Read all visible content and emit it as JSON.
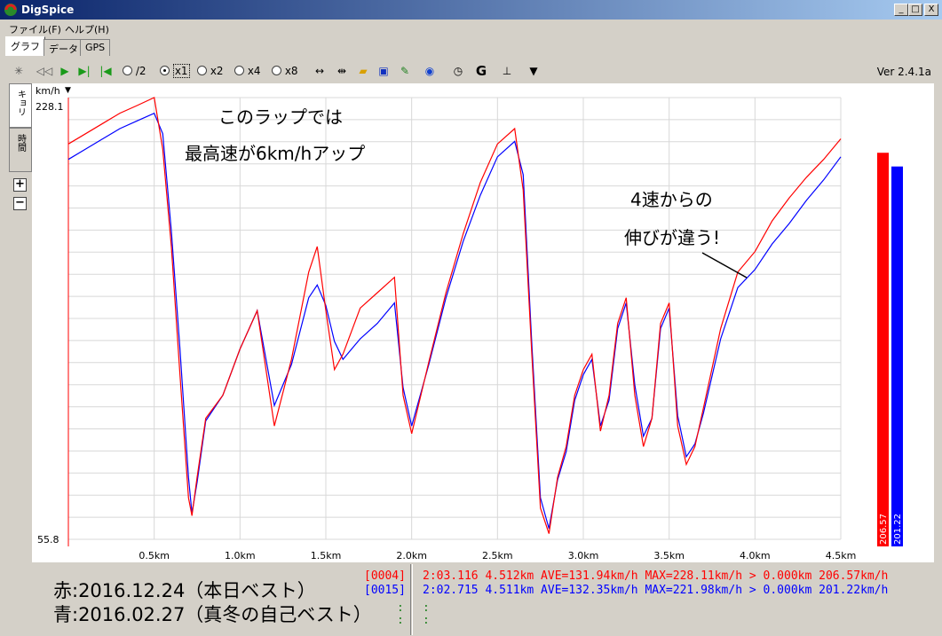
{
  "window": {
    "title": "DigSpice",
    "minimize": "_",
    "maximize": "□",
    "close": "X"
  },
  "menu": {
    "file": "ファイル(F)",
    "help": "ヘルプ(H)"
  },
  "tabs": [
    "グラフ",
    "データ",
    "GPS"
  ],
  "toolbar": {
    "radios": [
      {
        "label": "/2",
        "selected": false
      },
      {
        "label": "x1",
        "selected": true
      },
      {
        "label": "x2",
        "selected": false
      },
      {
        "label": "x4",
        "selected": false
      },
      {
        "label": "x8",
        "selected": false
      }
    ],
    "g_label": "G",
    "version": "Ver 2.4.1a"
  },
  "side": {
    "tab_distance": "キョリ",
    "tab_time": "時間",
    "zoom_in": "+",
    "zoom_out": "−"
  },
  "annotations": {
    "line1": "このラップでは",
    "line2": "最高速が6km/hアップ",
    "line3": "4速からの",
    "line4": "伸びが違う!"
  },
  "colors": {
    "red": "#ff0000",
    "blue": "#0000ff",
    "grid": "#d8d8d8"
  },
  "chart_data": {
    "type": "line",
    "ylabel": "km/h",
    "ylim": [
      55.8,
      228.1
    ],
    "y_tick_labels": [
      "228.1",
      "55.8"
    ],
    "xlim": [
      0,
      4.5
    ],
    "x_tick_labels": [
      "0.5km",
      "1.0km",
      "1.5km",
      "2.0km",
      "2.5km",
      "3.0km",
      "3.5km",
      "4.0km",
      "4.5km"
    ],
    "grid": true,
    "series": [
      {
        "color": "#ff0000",
        "x": [
          0,
          0.1,
          0.2,
          0.3,
          0.4,
          0.5,
          0.55,
          0.6,
          0.65,
          0.7,
          0.72,
          0.75,
          0.8,
          0.9,
          1.0,
          1.1,
          1.2,
          1.3,
          1.4,
          1.45,
          1.5,
          1.55,
          1.6,
          1.65,
          1.7,
          1.8,
          1.9,
          1.95,
          2.0,
          2.1,
          2.2,
          2.3,
          2.4,
          2.5,
          2.6,
          2.65,
          2.7,
          2.75,
          2.8,
          2.85,
          2.9,
          2.95,
          3.0,
          3.05,
          3.1,
          3.15,
          3.2,
          3.25,
          3.3,
          3.35,
          3.4,
          3.45,
          3.5,
          3.55,
          3.6,
          3.65,
          3.7,
          3.8,
          3.9,
          4.0,
          4.1,
          4.2,
          4.3,
          4.4,
          4.5
        ],
        "y": [
          210,
          214,
          218,
          222,
          225,
          228.1,
          208,
          170,
          120,
          72,
          65,
          80,
          103,
          112,
          130,
          145,
          100,
          126,
          160,
          170,
          145,
          122,
          128,
          137,
          146,
          152,
          158,
          112,
          97,
          125,
          152,
          175,
          195,
          210,
          216,
          192,
          128,
          68,
          58,
          80,
          92,
          112,
          122,
          128,
          98,
          112,
          140,
          150,
          112,
          92,
          103,
          140,
          148,
          100,
          85,
          92,
          107,
          138,
          160,
          168,
          180,
          189,
          197,
          204,
          212
        ]
      },
      {
        "color": "#0000ff",
        "x": [
          0,
          0.1,
          0.2,
          0.3,
          0.4,
          0.5,
          0.55,
          0.6,
          0.65,
          0.7,
          0.72,
          0.75,
          0.8,
          0.9,
          1.0,
          1.1,
          1.2,
          1.3,
          1.4,
          1.45,
          1.5,
          1.55,
          1.6,
          1.65,
          1.7,
          1.8,
          1.9,
          1.95,
          2.0,
          2.1,
          2.2,
          2.3,
          2.4,
          2.5,
          2.6,
          2.65,
          2.7,
          2.75,
          2.8,
          2.85,
          2.9,
          2.95,
          3.0,
          3.05,
          3.1,
          3.15,
          3.2,
          3.25,
          3.3,
          3.35,
          3.4,
          3.45,
          3.5,
          3.55,
          3.6,
          3.65,
          3.7,
          3.8,
          3.9,
          4.0,
          4.1,
          4.2,
          4.3,
          4.4,
          4.5
        ],
        "y": [
          204,
          208,
          212,
          216,
          219,
          221.98,
          214,
          176,
          130,
          80,
          66,
          78,
          102,
          112,
          130,
          145,
          108,
          124,
          150,
          155,
          147,
          133,
          126,
          130,
          134,
          140,
          148,
          115,
          100,
          124,
          150,
          172,
          190,
          205,
          211,
          198,
          132,
          72,
          60,
          79,
          90,
          110,
          120,
          126,
          100,
          110,
          138,
          148,
          116,
          96,
          103,
          138,
          146,
          104,
          88,
          93,
          105,
          134,
          154,
          161,
          171,
          179,
          188,
          196,
          205
        ]
      }
    ],
    "bars": [
      {
        "color": "#ff0000",
        "value": 206.57,
        "label": "206.57"
      },
      {
        "color": "#0000ff",
        "value": 201.22,
        "label": "201.22"
      }
    ]
  },
  "bottom": {
    "legend_red": "赤:2016.12.24（本日ベスト）",
    "legend_blue": "青:2016.02.27（真冬の自己ベスト）",
    "code_red": "[0004]",
    "code_blue": "[0015]",
    "dot": ":",
    "info_red": "2:03.116 4.512km AVE=131.94km/h MAX=228.11km/h > 0.000km 206.57km/h",
    "info_blue": "2:02.715 4.511km AVE=132.35km/h MAX=221.98km/h > 0.000km 201.22km/h"
  }
}
